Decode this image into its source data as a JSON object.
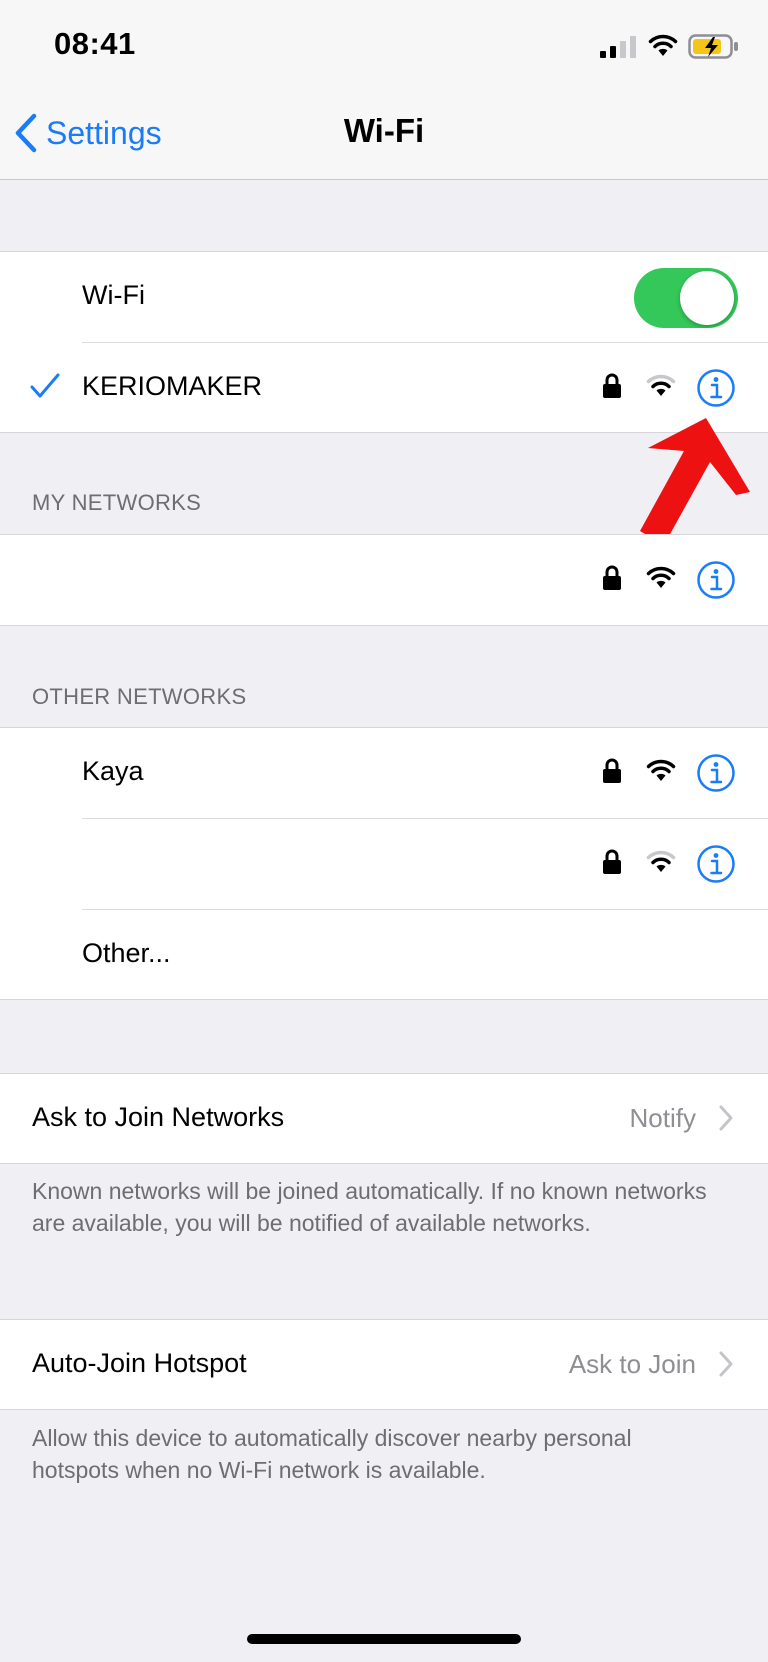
{
  "status_bar": {
    "time": "08:41",
    "battery_color": "#f5c518",
    "icons": [
      "cellular-signal-icon",
      "wifi-status-icon",
      "battery-charging-icon"
    ]
  },
  "nav": {
    "back_label": "Settings",
    "title": "Wi-Fi"
  },
  "wifi_toggle": {
    "label": "Wi-Fi",
    "on": true,
    "on_color": "#34c759"
  },
  "connected_network": {
    "name": "KERIOMAKER",
    "secured": true
  },
  "my_networks": {
    "header": "MY NETWORKS"
  },
  "other_networks": {
    "header": "OTHER NETWORKS",
    "kaya": "Kaya",
    "other_label": "Other..."
  },
  "ask_to_join": {
    "label": "Ask to Join Networks",
    "value": "Notify",
    "footer": "Known networks will be joined automatically. If no known networks are available, you will be notified of available networks."
  },
  "auto_join": {
    "label": "Auto-Join Hotspot",
    "value": "Ask to Join",
    "footer": "Allow this device to automatically discover nearby personal hotspots when no Wi-Fi network is available."
  },
  "colors": {
    "accent": "#1a7cf6",
    "annotation_arrow": "#ee1111"
  }
}
